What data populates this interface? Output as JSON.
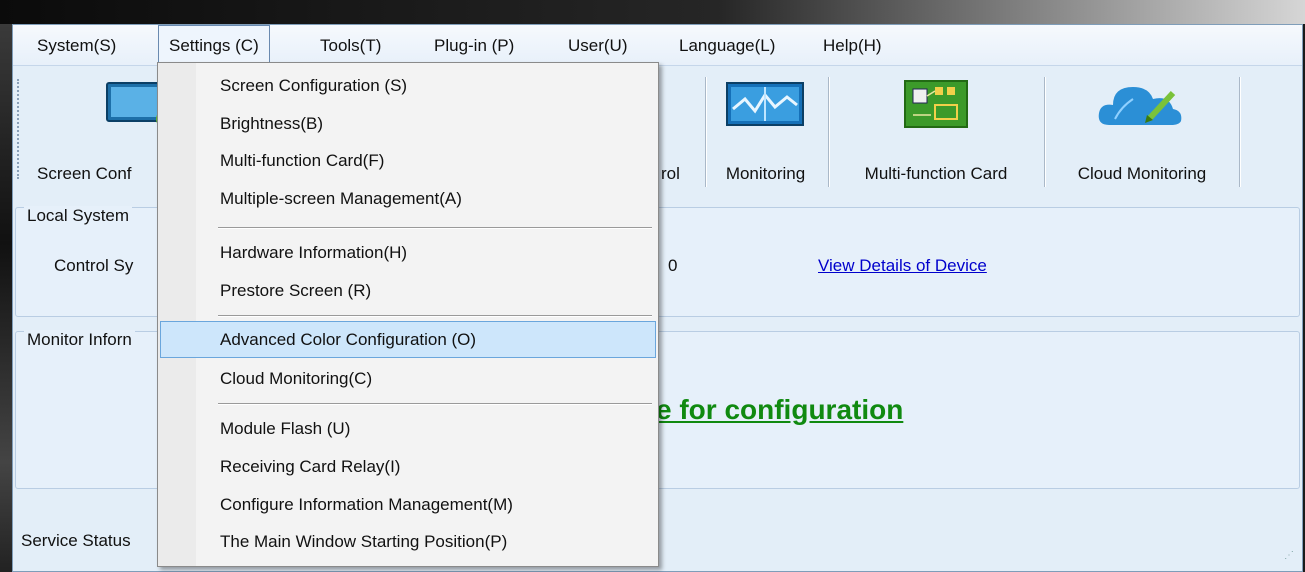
{
  "menubar": {
    "items": [
      "System(S)",
      "Settings (C)",
      "Tools(T)",
      "Plug-in (P)",
      "User(U)",
      "Language(L)",
      "Help(H)"
    ]
  },
  "toolbar": {
    "items": [
      {
        "label": "Screen Conf",
        "icon": "screen-config-icon"
      },
      {
        "label": "rol",
        "icon": ""
      },
      {
        "label": "Monitoring",
        "icon": "monitoring-icon"
      },
      {
        "label": "Multi-function Card",
        "icon": "circuit-board-icon"
      },
      {
        "label": "Cloud Monitoring",
        "icon": "cloud-edit-icon"
      }
    ]
  },
  "local_system": {
    "title": "Local System",
    "control_label": "Control Sy",
    "count_fragment": "0",
    "view_details": "View Details of Device"
  },
  "monitor": {
    "title": "Monitor Inforn",
    "config_text": "e for configuration"
  },
  "service": {
    "label": "Service Status"
  },
  "dropdown": {
    "items": [
      "Screen Configuration (S)",
      "Brightness(B)",
      "Multi-function Card(F)",
      "Multiple-screen Management(A)",
      "Hardware Information(H)",
      "Prestore Screen (R)",
      "Advanced Color Configuration (O)",
      "Cloud Monitoring(C)",
      "Module Flash (U)",
      "Receiving Card Relay(I)",
      "Configure Information Management(M)",
      "The Main Window Starting Position(P)"
    ],
    "highlighted": "Advanced Color Configuration (O)"
  },
  "colors": {
    "link": "#0000cc",
    "config_link": "#108a10",
    "highlight": "#cde6fb",
    "window_bg": "#e3eef8"
  }
}
